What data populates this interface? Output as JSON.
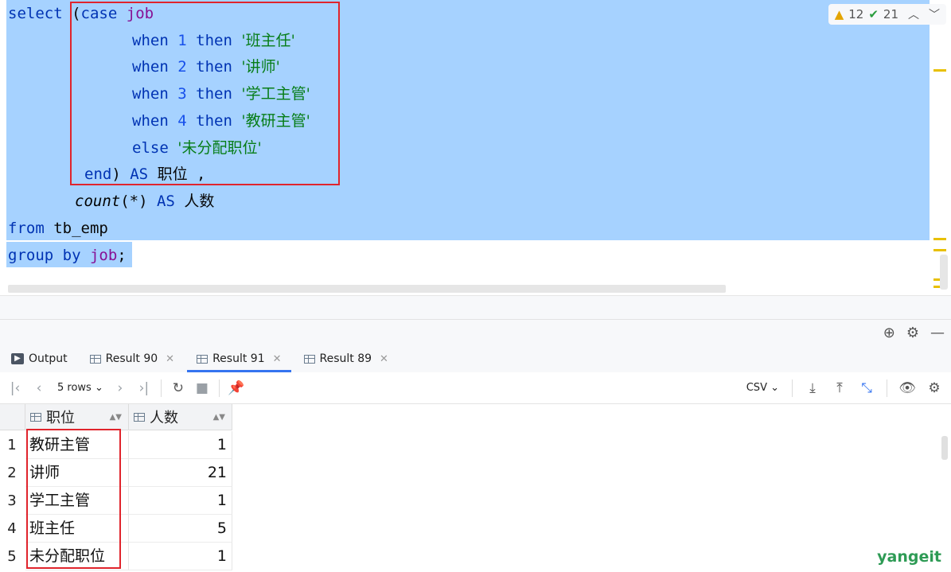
{
  "editor": {
    "line1": {
      "kw": "select",
      "paren": " (",
      "case": "case",
      "sp": " ",
      "col": "job"
    },
    "whens": [
      {
        "kw_when": "when",
        "num": "1",
        "kw_then": "then",
        "str": "'班主任'"
      },
      {
        "kw_when": "when",
        "num": "2",
        "kw_then": "then",
        "str": "'讲师'"
      },
      {
        "kw_when": "when",
        "num": "3",
        "kw_then": "then",
        "str": "'学工主管'"
      },
      {
        "kw_when": "when",
        "num": "4",
        "kw_then": "then",
        "str": "'教研主管'"
      }
    ],
    "else_kw": "else",
    "else_str": "'未分配职位'",
    "end_kw": "end",
    "end_paren": ")",
    "as_kw": "AS",
    "alias1": "职位",
    "comma": " ,",
    "count_fn": "count",
    "count_args": "(*)",
    "alias2": "人数",
    "from_kw": "from",
    "table": "tb_emp",
    "group_kw": "group by",
    "group_col": "job",
    "semicolon": ";"
  },
  "inspections": {
    "warnings": "12",
    "weak": "21"
  },
  "tabs": [
    {
      "label": "Output",
      "icon": "output-icon"
    },
    {
      "label": "Result 90",
      "icon": "grid-icon"
    },
    {
      "label": "Result 91",
      "icon": "grid-icon",
      "active": true
    },
    {
      "label": "Result 89",
      "icon": "grid-icon"
    }
  ],
  "toolbar": {
    "rows_label": "5 rows",
    "format": "CSV"
  },
  "grid": {
    "columns": [
      "职位",
      "人数"
    ],
    "rows": [
      {
        "n": "1",
        "job": "教研主管",
        "count": "1"
      },
      {
        "n": "2",
        "job": "讲师",
        "count": "21"
      },
      {
        "n": "3",
        "job": "学工主管",
        "count": "1"
      },
      {
        "n": "4",
        "job": "班主任",
        "count": "5"
      },
      {
        "n": "5",
        "job": "未分配职位",
        "count": "1"
      }
    ]
  },
  "watermark": "yangeit",
  "colors": {
    "selection": "#a6d2ff",
    "highlight_box": "#e0242c",
    "accent_tab": "#3574f0"
  }
}
